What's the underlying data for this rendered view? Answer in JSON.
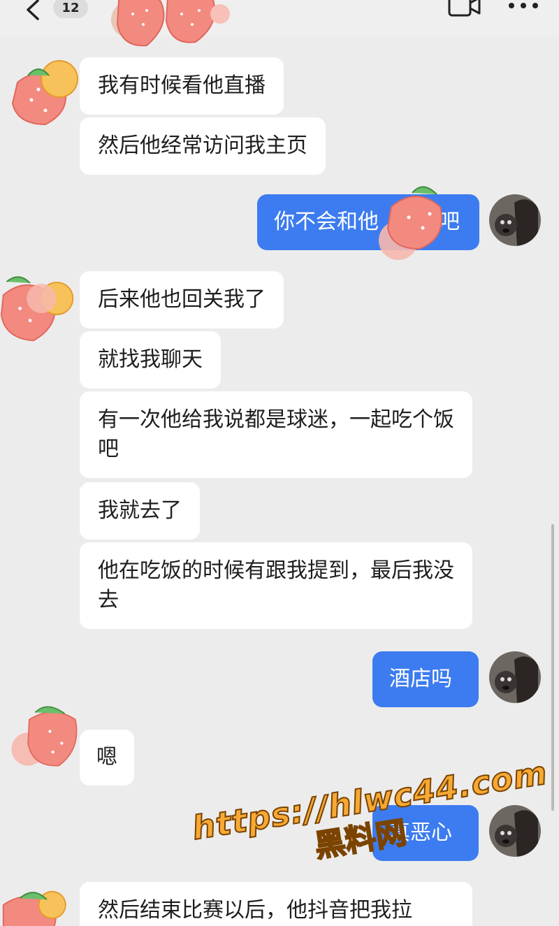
{
  "header": {
    "unread_count": "12"
  },
  "messages": [
    {
      "side": "in",
      "text": "我有时候看他直播"
    },
    {
      "side": "in",
      "text": "然后他经常访问我主页"
    },
    {
      "side": "out",
      "text": "你不会和他",
      "text_tail": "吧"
    },
    {
      "side": "in",
      "text": "后来他也回关我了"
    },
    {
      "side": "in",
      "text": "就找我聊天"
    },
    {
      "side": "in",
      "text": "有一次他给我说都是球迷，一起吃个饭吧"
    },
    {
      "side": "in",
      "text": "我就去了"
    },
    {
      "side": "in",
      "text": "他在吃饭的时候有跟我提到，最后我没去"
    },
    {
      "side": "out",
      "text": "酒店吗"
    },
    {
      "side": "in",
      "text": "嗯"
    },
    {
      "side": "out",
      "text": "真恶心"
    },
    {
      "side": "in",
      "text": "然后结束比赛以后，他抖音把我拉"
    }
  ],
  "watermark": {
    "url": "https://hlwc44.com",
    "name": "黑料网"
  },
  "colors": {
    "background": "#ececec",
    "incoming_bubble": "#ffffff",
    "outgoing_bubble": "#3d7cf0",
    "watermark": "#f6a935"
  },
  "icons": [
    "back-arrow-icon",
    "video-call-icon",
    "more-dots-icon",
    "strawberry-sticker"
  ]
}
